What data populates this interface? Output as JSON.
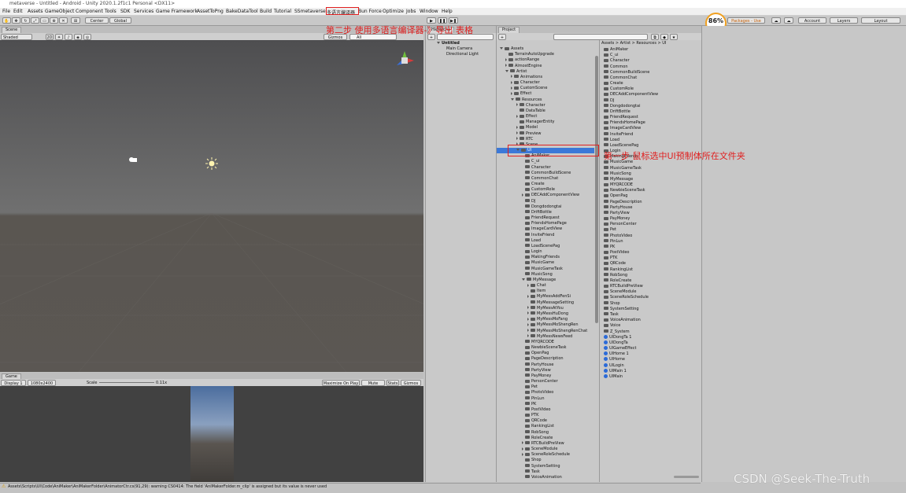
{
  "window": {
    "title": "metaverse - Untitled - Android - Unity 2020.1.2f1c1 Personal <DX11>"
  },
  "menu": [
    "File",
    "Edit",
    "Assets",
    "GameObject",
    "Component",
    "Tools",
    "SDK",
    "Services",
    "Game Framework",
    "AssetToPng",
    "BakeDataTool",
    "Build",
    "Tutorial",
    "SSmetaverse",
    "多语言编译器",
    "Bun Force",
    "Optimize",
    "Jobs",
    "Window",
    "Help"
  ],
  "toolbar": {
    "pivot": "Center",
    "space": "Global",
    "play": "▶",
    "pause": "❚❚",
    "step": "▶❚",
    "packages": "Packages - Use",
    "account": "Account",
    "layers": "Layers",
    "layout": "Layout",
    "cpu_percent": "86%"
  },
  "scene": {
    "tab": "Scene",
    "shading": "Shaded",
    "mode_2d": "2D",
    "gizmos": "Gizmos",
    "search": "All"
  },
  "hierarchy": {
    "tab": "Hierarchy",
    "scene_name": "Untitled",
    "items": [
      "Main Camera",
      "Directional Light"
    ]
  },
  "project": {
    "tab": "Project",
    "breadcrumb": "Assets > Artist > Resources > UI"
  },
  "project_tree": [
    {
      "label": "Assets",
      "indent": 0,
      "arrow": "open"
    },
    {
      "label": "TerrainAutoUpgrade",
      "indent": 1,
      "arrow": "none"
    },
    {
      "label": "actionRange",
      "indent": 1,
      "arrow": "closed"
    },
    {
      "label": "AlmostEngine",
      "indent": 1,
      "arrow": "closed"
    },
    {
      "label": "Artist",
      "indent": 1,
      "arrow": "open"
    },
    {
      "label": "Animations",
      "indent": 2,
      "arrow": "closed"
    },
    {
      "label": "Character",
      "indent": 2,
      "arrow": "closed"
    },
    {
      "label": "CustomScene",
      "indent": 2,
      "arrow": "closed"
    },
    {
      "label": "Effect",
      "indent": 2,
      "arrow": "closed"
    },
    {
      "label": "Resources",
      "indent": 2,
      "arrow": "open"
    },
    {
      "label": "Character",
      "indent": 3,
      "arrow": "closed"
    },
    {
      "label": "DataTable",
      "indent": 3,
      "arrow": "none"
    },
    {
      "label": "Effect",
      "indent": 3,
      "arrow": "closed"
    },
    {
      "label": "ManagerEntity",
      "indent": 3,
      "arrow": "none"
    },
    {
      "label": "Model",
      "indent": 3,
      "arrow": "closed"
    },
    {
      "label": "Preview",
      "indent": 3,
      "arrow": "closed"
    },
    {
      "label": "RTC",
      "indent": 3,
      "arrow": "closed"
    },
    {
      "label": "Scene",
      "indent": 3,
      "arrow": "closed"
    },
    {
      "label": "UI",
      "indent": 3,
      "arrow": "open",
      "selected": true
    },
    {
      "label": "AniMaker",
      "indent": 4,
      "arrow": "none"
    },
    {
      "label": "C_ui",
      "indent": 4,
      "arrow": "none"
    },
    {
      "label": "Character",
      "indent": 4,
      "arrow": "none"
    },
    {
      "label": "CommonBuildScene",
      "indent": 4,
      "arrow": "none"
    },
    {
      "label": "CommonChat",
      "indent": 4,
      "arrow": "none"
    },
    {
      "label": "Create",
      "indent": 4,
      "arrow": "none"
    },
    {
      "label": "CustomRole",
      "indent": 4,
      "arrow": "none"
    },
    {
      "label": "DECAddComponentView",
      "indent": 4,
      "arrow": "closed"
    },
    {
      "label": "DJ",
      "indent": 4,
      "arrow": "none"
    },
    {
      "label": "Dongdodongtai",
      "indent": 4,
      "arrow": "none"
    },
    {
      "label": "DriftBottle",
      "indent": 4,
      "arrow": "none"
    },
    {
      "label": "FriendRequest",
      "indent": 4,
      "arrow": "none"
    },
    {
      "label": "FriendsHomePage",
      "indent": 4,
      "arrow": "none"
    },
    {
      "label": "ImageCardView",
      "indent": 4,
      "arrow": "none"
    },
    {
      "label": "InviteFriend",
      "indent": 4,
      "arrow": "none"
    },
    {
      "label": "Load",
      "indent": 4,
      "arrow": "none"
    },
    {
      "label": "LoadScenePag",
      "indent": 4,
      "arrow": "none"
    },
    {
      "label": "Login",
      "indent": 4,
      "arrow": "none"
    },
    {
      "label": "MakingFriends",
      "indent": 4,
      "arrow": "none"
    },
    {
      "label": "MusicGame",
      "indent": 4,
      "arrow": "none"
    },
    {
      "label": "MusicGameTask",
      "indent": 4,
      "arrow": "none"
    },
    {
      "label": "MusicSong",
      "indent": 4,
      "arrow": "none"
    },
    {
      "label": "MyMessage",
      "indent": 4,
      "arrow": "open"
    },
    {
      "label": "Chat",
      "indent": 5,
      "arrow": "closed"
    },
    {
      "label": "Item",
      "indent": 5,
      "arrow": "none"
    },
    {
      "label": "MyMessAddFenSi",
      "indent": 5,
      "arrow": "closed"
    },
    {
      "label": "MyMessageSetting",
      "indent": 5,
      "arrow": "none"
    },
    {
      "label": "MyMessAtYou",
      "indent": 5,
      "arrow": "closed"
    },
    {
      "label": "MyMessHuDong",
      "indent": 5,
      "arrow": "closed"
    },
    {
      "label": "MyMessMoFang",
      "indent": 5,
      "arrow": "closed"
    },
    {
      "label": "MyMessMoShengRen",
      "indent": 5,
      "arrow": "closed"
    },
    {
      "label": "MyMessMoShengRenChat",
      "indent": 5,
      "arrow": "closed"
    },
    {
      "label": "MyMessNewsFeed",
      "indent": 5,
      "arrow": "closed"
    },
    {
      "label": "MYQRCODE",
      "indent": 4,
      "arrow": "none"
    },
    {
      "label": "NewbieSceneTask",
      "indent": 4,
      "arrow": "none"
    },
    {
      "label": "OpenPag",
      "indent": 4,
      "arrow": "none"
    },
    {
      "label": "PageDescription",
      "indent": 4,
      "arrow": "none"
    },
    {
      "label": "PartyHouse",
      "indent": 4,
      "arrow": "none"
    },
    {
      "label": "PartyView",
      "indent": 4,
      "arrow": "none"
    },
    {
      "label": "PayMoney",
      "indent": 4,
      "arrow": "none"
    },
    {
      "label": "PersonCenter",
      "indent": 4,
      "arrow": "none"
    },
    {
      "label": "Pet",
      "indent": 4,
      "arrow": "none"
    },
    {
      "label": "PhotoVideo",
      "indent": 4,
      "arrow": "none"
    },
    {
      "label": "PinLun",
      "indent": 4,
      "arrow": "none"
    },
    {
      "label": "PK",
      "indent": 4,
      "arrow": "none"
    },
    {
      "label": "PostVideo",
      "indent": 4,
      "arrow": "none"
    },
    {
      "label": "PTK",
      "indent": 4,
      "arrow": "none"
    },
    {
      "label": "QRCode",
      "indent": 4,
      "arrow": "none"
    },
    {
      "label": "RankingList",
      "indent": 4,
      "arrow": "none"
    },
    {
      "label": "RobSong",
      "indent": 4,
      "arrow": "none"
    },
    {
      "label": "RoleCreate",
      "indent": 4,
      "arrow": "none"
    },
    {
      "label": "RTCBuildPreView",
      "indent": 4,
      "arrow": "closed"
    },
    {
      "label": "SceneModule",
      "indent": 4,
      "arrow": "closed"
    },
    {
      "label": "SceneRoleSchedule",
      "indent": 4,
      "arrow": "closed"
    },
    {
      "label": "Shop",
      "indent": 4,
      "arrow": "none"
    },
    {
      "label": "SystemSetting",
      "indent": 4,
      "arrow": "none"
    },
    {
      "label": "Task",
      "indent": 4,
      "arrow": "none"
    },
    {
      "label": "VoiceAnimation",
      "indent": 4,
      "arrow": "none"
    }
  ],
  "project_list": [
    {
      "label": "AniMaker",
      "type": "folder"
    },
    {
      "label": "C_ui",
      "type": "folder"
    },
    {
      "label": "Character",
      "type": "folder"
    },
    {
      "label": "Common",
      "type": "folder"
    },
    {
      "label": "CommonBuildScene",
      "type": "folder"
    },
    {
      "label": "CommonChat",
      "type": "folder"
    },
    {
      "label": "Create",
      "type": "folder"
    },
    {
      "label": "CustomRole",
      "type": "folder"
    },
    {
      "label": "DECAddComponentView",
      "type": "folder"
    },
    {
      "label": "DJ",
      "type": "folder"
    },
    {
      "label": "Dongdodongtai",
      "type": "folder"
    },
    {
      "label": "DriftBottle",
      "type": "folder"
    },
    {
      "label": "FriendRequest",
      "type": "folder"
    },
    {
      "label": "FriendsHomePage",
      "type": "folder"
    },
    {
      "label": "ImageCardView",
      "type": "folder"
    },
    {
      "label": "InviteFriend",
      "type": "folder"
    },
    {
      "label": "Load",
      "type": "folder"
    },
    {
      "label": "LoadScenePag",
      "type": "folder"
    },
    {
      "label": "Login",
      "type": "folder"
    },
    {
      "label": "MakingFriends",
      "type": "folder"
    },
    {
      "label": "MusicGame",
      "type": "folder"
    },
    {
      "label": "MusicGameTask",
      "type": "folder"
    },
    {
      "label": "MusicSong",
      "type": "folder"
    },
    {
      "label": "MyMessage",
      "type": "folder"
    },
    {
      "label": "MYQRCODE",
      "type": "folder"
    },
    {
      "label": "NewbieSceneTask",
      "type": "folder"
    },
    {
      "label": "OpenPag",
      "type": "folder"
    },
    {
      "label": "PageDescription",
      "type": "folder"
    },
    {
      "label": "PartyHouse",
      "type": "folder"
    },
    {
      "label": "PartyView",
      "type": "folder"
    },
    {
      "label": "PayMoney",
      "type": "folder"
    },
    {
      "label": "PersonCenter",
      "type": "folder"
    },
    {
      "label": "Pet",
      "type": "folder"
    },
    {
      "label": "PhotoVideo",
      "type": "folder"
    },
    {
      "label": "PinLun",
      "type": "folder"
    },
    {
      "label": "PK",
      "type": "folder"
    },
    {
      "label": "PostVideo",
      "type": "folder"
    },
    {
      "label": "PTK",
      "type": "folder"
    },
    {
      "label": "QRCode",
      "type": "folder"
    },
    {
      "label": "RankingList",
      "type": "folder"
    },
    {
      "label": "RobSong",
      "type": "folder"
    },
    {
      "label": "RoleCreate",
      "type": "folder"
    },
    {
      "label": "RTCBuildPreView",
      "type": "folder"
    },
    {
      "label": "SceneModule",
      "type": "folder"
    },
    {
      "label": "SceneRoleSchedule",
      "type": "folder"
    },
    {
      "label": "Shop",
      "type": "folder"
    },
    {
      "label": "SystemSetting",
      "type": "folder"
    },
    {
      "label": "Task",
      "type": "folder"
    },
    {
      "label": "VoiceAnimation",
      "type": "folder"
    },
    {
      "label": "Voice",
      "type": "folder"
    },
    {
      "label": "Z_System",
      "type": "folder"
    },
    {
      "label": "UIDongTa 1",
      "type": "prefab"
    },
    {
      "label": "UIDongTa",
      "type": "prefab"
    },
    {
      "label": "UIGameEffect",
      "type": "prefab"
    },
    {
      "label": "UIHome 1",
      "type": "prefab"
    },
    {
      "label": "UIHome",
      "type": "prefab"
    },
    {
      "label": "UILogin",
      "type": "prefab"
    },
    {
      "label": "UIMain 1",
      "type": "prefab"
    },
    {
      "label": "UIMain",
      "type": "prefab"
    }
  ],
  "game": {
    "tab": "Game",
    "display": "Display 1",
    "resolution": "1080x2400",
    "scale_label": "Scale",
    "scale_value": "0.11x",
    "maximize": "Maximize On Play",
    "mute": "Mute Audio",
    "stats": "Stats",
    "gizmos": "Gizmos"
  },
  "status": {
    "message": "Assets\\Scripts\\UI\\Code\\AniMaker\\AniMakerFolder\\AnimatorCtr.cs(91,29): warning CS0414: The field 'AniMakerFolder.m_clip' is assigned but its value is never used"
  },
  "annotations": {
    "step1": "第一步 鼠标选中UI预制体所在文件夹",
    "step2": "第二步 使用多语言编译器-》导出 表格"
  },
  "watermark": "CSDN @Seek-The-Truth",
  "colors": {
    "selection": "#3b78d8",
    "annotation": "#e02020",
    "prefab": "#2b6ad8"
  }
}
